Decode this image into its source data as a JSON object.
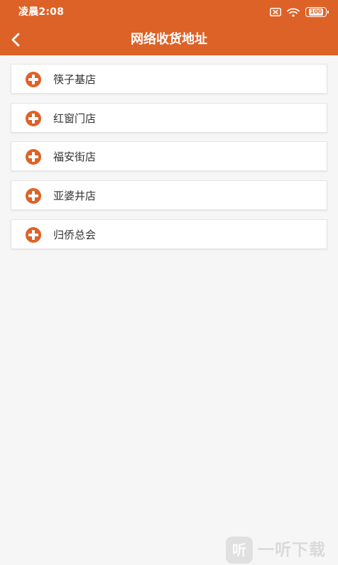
{
  "status_bar": {
    "time": "凌晨2:08",
    "battery": "100"
  },
  "nav": {
    "title": "网络收货地址"
  },
  "list": {
    "items": [
      {
        "label": "筷子基店"
      },
      {
        "label": "红窗门店"
      },
      {
        "label": "福安街店"
      },
      {
        "label": "亚婆井店"
      },
      {
        "label": "归侨总会"
      }
    ]
  },
  "watermark": {
    "mark": "听",
    "text": "一听下载"
  },
  "colors": {
    "accent": "#dd6227",
    "background": "#f6f6f6",
    "card": "#ffffff",
    "text": "#333333"
  },
  "icons": {
    "back": "chevron-left-icon",
    "sim": "sim-card-icon",
    "wifi": "wifi-icon",
    "battery": "battery-icon",
    "add": "plus-circle-icon"
  }
}
